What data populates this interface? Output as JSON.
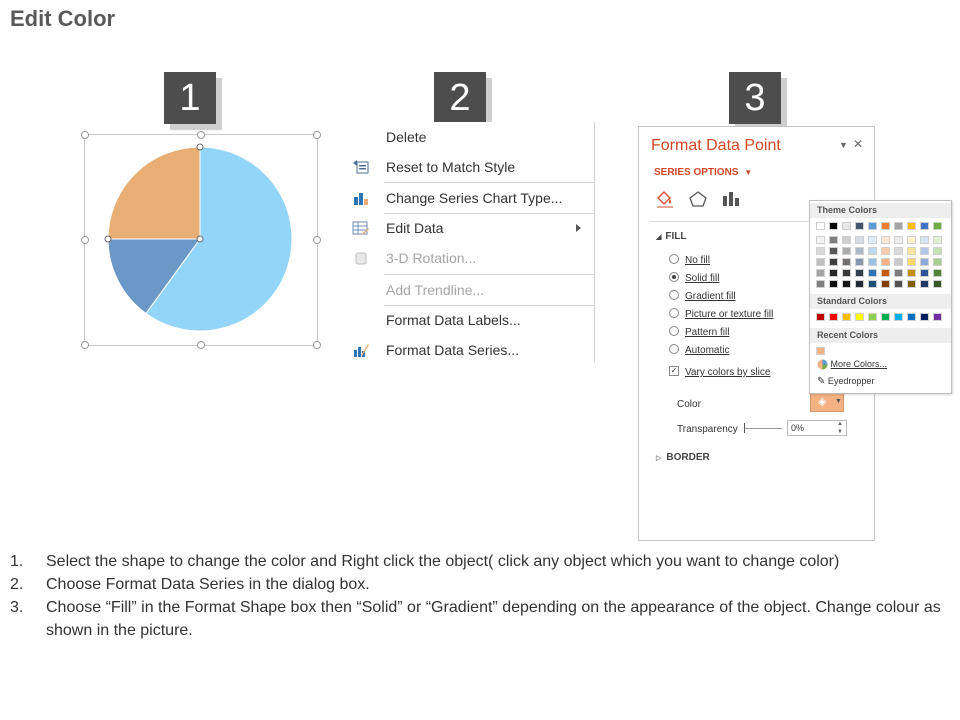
{
  "page": {
    "title": "Edit Color"
  },
  "badges": [
    "1",
    "2",
    "3"
  ],
  "pie": {
    "slices": [
      {
        "value": 60,
        "color": "#93d5f9"
      },
      {
        "value": 15,
        "color": "#6b98c6"
      },
      {
        "value": 25,
        "color": "#e9ae76"
      }
    ]
  },
  "context_menu": {
    "items": [
      {
        "label": "Delete",
        "icon": "none",
        "disabled": false
      },
      {
        "label": "Reset to Match Style",
        "icon": "reset-style-icon",
        "disabled": false
      },
      {
        "label": "Change Series Chart Type...",
        "icon": "chart-type-icon",
        "disabled": false
      },
      {
        "label": "Edit Data",
        "icon": "edit-data-icon",
        "disabled": false
      },
      {
        "label": "3-D Rotation...",
        "icon": "rotation-icon",
        "disabled": true
      },
      {
        "label": "Add Trendline...",
        "icon": "none",
        "disabled": true
      },
      {
        "label": "Format Data Labels...",
        "icon": "none",
        "disabled": false
      },
      {
        "label": "Format Data Series...",
        "icon": "format-series-icon",
        "disabled": false
      }
    ]
  },
  "format_pane": {
    "title": "Format Data Point",
    "series_options": "SERIES OPTIONS",
    "fill_section": "FILL",
    "fill_options": [
      {
        "label": "No fill",
        "selected": false
      },
      {
        "label": "Solid fill",
        "selected": true
      },
      {
        "label": "Gradient fill",
        "selected": false
      },
      {
        "label": "Picture or texture fill",
        "selected": false
      },
      {
        "label": "Pattern fill",
        "selected": false
      },
      {
        "label": "Automatic",
        "selected": false
      }
    ],
    "vary_colors": "Vary colors by slice",
    "color_label": "Color",
    "transparency_label": "Transparency",
    "transparency_value": "0%",
    "border_section": "BORDER"
  },
  "palette": {
    "theme_header": "Theme Colors",
    "theme_top": [
      "#ffffff",
      "#000000",
      "#e7e6e6",
      "#44546a",
      "#5b9bd5",
      "#ed7d31",
      "#a5a5a5",
      "#ffc000",
      "#4472c4",
      "#70ad47"
    ],
    "theme_shades": [
      [
        "#f2f2f2",
        "#7f7f7f",
        "#d0cece",
        "#d6dce4",
        "#deebf6",
        "#fbe5d5",
        "#ededed",
        "#fff2cc",
        "#d9e2f3",
        "#e2efd9"
      ],
      [
        "#d8d8d8",
        "#595959",
        "#aeabab",
        "#adb9ca",
        "#bdd7ee",
        "#f7cbac",
        "#dbdbdb",
        "#fee599",
        "#b4c6e7",
        "#c5e0b3"
      ],
      [
        "#bfbfbf",
        "#3f3f3f",
        "#757070",
        "#8496b0",
        "#9cc3e5",
        "#f4b183",
        "#c9c9c9",
        "#ffd965",
        "#8eaadb",
        "#a8d08d"
      ],
      [
        "#a5a5a5",
        "#262626",
        "#3a3838",
        "#323f4f",
        "#2e75b5",
        "#c55a11",
        "#7b7b7b",
        "#bf9000",
        "#2f5496",
        "#538135"
      ],
      [
        "#7f7f7f",
        "#0c0c0c",
        "#171616",
        "#222a35",
        "#1e4e79",
        "#833c0b",
        "#525252",
        "#7f6000",
        "#1f3864",
        "#375623"
      ]
    ],
    "standard_header": "Standard Colors",
    "standard": [
      "#c00000",
      "#ff0000",
      "#ffc000",
      "#ffff00",
      "#92d050",
      "#00b050",
      "#00b0f0",
      "#0070c0",
      "#002060",
      "#7030a0"
    ],
    "recent_header": "Recent Colors",
    "recent": [
      "#f4b183"
    ],
    "more_colors": "More Colors...",
    "eyedropper": "Eyedropper"
  },
  "instructions": [
    {
      "num": "1.",
      "text": "Select the shape to change the color and Right click the object( click any object which you want to change color)"
    },
    {
      "num": "2.",
      "text": "Choose Format Data Series in the dialog box."
    },
    {
      "num": "3.",
      "text": "Choose “Fill” in the Format Shape box then “Solid” or “Gradient” depending on the appearance of the object. Change colour as shown in the picture."
    }
  ]
}
